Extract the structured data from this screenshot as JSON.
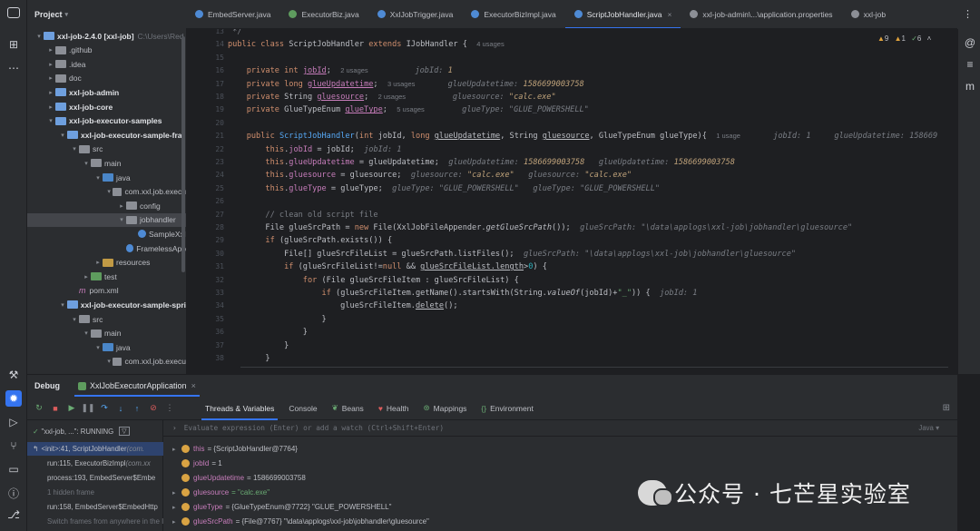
{
  "project_panel": {
    "title": "Project",
    "tree": [
      {
        "label": "xxl-job-2.4.0 [xxl-job]",
        "extra": "C:\\Users\\Red",
        "kind": "folder mod",
        "depth": 0,
        "arrow": "▾",
        "bold": true
      },
      {
        "label": ".github",
        "kind": "folder",
        "depth": 1,
        "arrow": "▸"
      },
      {
        "label": ".idea",
        "kind": "folder",
        "depth": 1,
        "arrow": "▸"
      },
      {
        "label": "doc",
        "kind": "folder",
        "depth": 1,
        "arrow": "▸"
      },
      {
        "label": "xxl-job-admin",
        "kind": "folder mod",
        "depth": 1,
        "arrow": "▸",
        "bold": true
      },
      {
        "label": "xxl-job-core",
        "kind": "folder mod",
        "depth": 1,
        "arrow": "▸",
        "bold": true
      },
      {
        "label": "xxl-job-executor-samples",
        "kind": "folder mod",
        "depth": 1,
        "arrow": "▾",
        "bold": true
      },
      {
        "label": "xxl-job-executor-sample-fra",
        "kind": "folder mod",
        "depth": 2,
        "arrow": "▾",
        "bold": true
      },
      {
        "label": "src",
        "kind": "folder",
        "depth": 3,
        "arrow": "▾"
      },
      {
        "label": "main",
        "kind": "folder",
        "depth": 4,
        "arrow": "▾"
      },
      {
        "label": "java",
        "kind": "folder src",
        "depth": 5,
        "arrow": "▾"
      },
      {
        "label": "com.xxl.job.execu",
        "kind": "folder",
        "depth": 6,
        "arrow": "▾"
      },
      {
        "label": "config",
        "kind": "folder",
        "depth": 7,
        "arrow": "▸"
      },
      {
        "label": "jobhandler",
        "kind": "folder",
        "depth": 7,
        "arrow": "▾",
        "selected": true
      },
      {
        "label": "SampleXxl",
        "kind": "jfile",
        "depth": 8,
        "arrow": ""
      },
      {
        "label": "FramelessApp",
        "kind": "jfile",
        "depth": 7,
        "arrow": ""
      },
      {
        "label": "resources",
        "kind": "folder res",
        "depth": 5,
        "arrow": "▸"
      },
      {
        "label": "test",
        "kind": "folder tst",
        "depth": 4,
        "arrow": "▸"
      },
      {
        "label": "pom.xml",
        "kind": "pom",
        "depth": 3,
        "arrow": ""
      },
      {
        "label": "xxl-job-executor-sample-spri",
        "kind": "folder mod",
        "depth": 2,
        "arrow": "▾",
        "bold": true
      },
      {
        "label": "src",
        "kind": "folder",
        "depth": 3,
        "arrow": "▾"
      },
      {
        "label": "main",
        "kind": "folder",
        "depth": 4,
        "arrow": "▾"
      },
      {
        "label": "java",
        "kind": "folder src",
        "depth": 5,
        "arrow": "▾"
      },
      {
        "label": "com.xxl.job.execu",
        "kind": "folder",
        "depth": 6,
        "arrow": "▾"
      }
    ]
  },
  "editor_tabs": [
    {
      "label": "EmbedServer.java",
      "color": "#4e8ad4",
      "active": false
    },
    {
      "label": "ExecutorBiz.java",
      "color": "#5e9c5e",
      "active": false
    },
    {
      "label": "XxlJobTrigger.java",
      "color": "#4e8ad4",
      "active": false
    },
    {
      "label": "ExecutorBizImpl.java",
      "color": "#4e8ad4",
      "active": false
    },
    {
      "label": "ScriptJobHandler.java",
      "color": "#4e8ad4",
      "active": true
    },
    {
      "label": "xxl-job-admin\\...\\application.properties",
      "color": "#8c8f96",
      "active": false
    },
    {
      "label": "xxl-job",
      "color": "#8c8f96",
      "active": false
    }
  ],
  "inspections": {
    "warnings": "9",
    "weak": "1",
    "typos": "6"
  },
  "line_numbers": [
    "13",
    "14",
    "15",
    "16",
    "17",
    "18",
    "19",
    "20",
    "21",
    "22",
    "23",
    "24",
    "25",
    "26",
    "27",
    "28",
    "29",
    "30",
    "31",
    "32",
    "33",
    "34",
    "35",
    "36",
    "37",
    "38"
  ],
  "debug": {
    "title": "Debug",
    "config": "XxlJobExecutorApplication",
    "tabs": [
      "Threads & Variables",
      "Console",
      "Beans",
      "Health",
      "Mappings",
      "Environment"
    ],
    "thread": "\"xxl-job, ...\": RUNNING",
    "eval_placeholder": "Evaluate expression (Enter) or add a watch (Ctrl+Shift+Enter)",
    "eval_lang": "Java",
    "frames": [
      {
        "text": "<init>:41, ScriptJobHandler",
        "cls": "(com.",
        "selected": true
      },
      {
        "text": "run:115, ExecutorBizImpl",
        "cls": "(com.xx"
      },
      {
        "text": "process:193, EmbedServer$Embe",
        "cls": ""
      },
      {
        "text": "1 hidden frame",
        "cls": "",
        "dim": true
      },
      {
        "text": "run:158, EmbedServer$EmbedHttp",
        "cls": ""
      },
      {
        "text": "Switch frames from anywhere in the I...",
        "cls": "",
        "dim": true
      }
    ],
    "variables": [
      {
        "name": "this",
        "value": "= {ScriptJobHandler@7764}",
        "expand": true,
        "type": "obj"
      },
      {
        "name": "jobId",
        "value": "= 1",
        "expand": false,
        "type": "prim"
      },
      {
        "name": "glueUpdatetime",
        "value": "= 1586699003758",
        "expand": false,
        "type": "prim"
      },
      {
        "name": "gluesource",
        "value": "= \"calc.exe\"",
        "expand": true,
        "type": "str"
      },
      {
        "name": "glueType",
        "value": "= {GlueTypeEnum@7722} \"GLUE_POWERSHELL\"",
        "expand": true,
        "type": "obj"
      },
      {
        "name": "glueSrcPath",
        "value": "= {File@7767} \"\\data\\applogs\\xxl-job\\jobhandler\\gluesource\"",
        "expand": true,
        "type": "obj"
      }
    ]
  },
  "watermark": "公众号 · 七芒星实验室",
  "colors": {
    "accent": "#3574f0",
    "bg": "#1e1f22",
    "panel": "#2b2d30"
  }
}
